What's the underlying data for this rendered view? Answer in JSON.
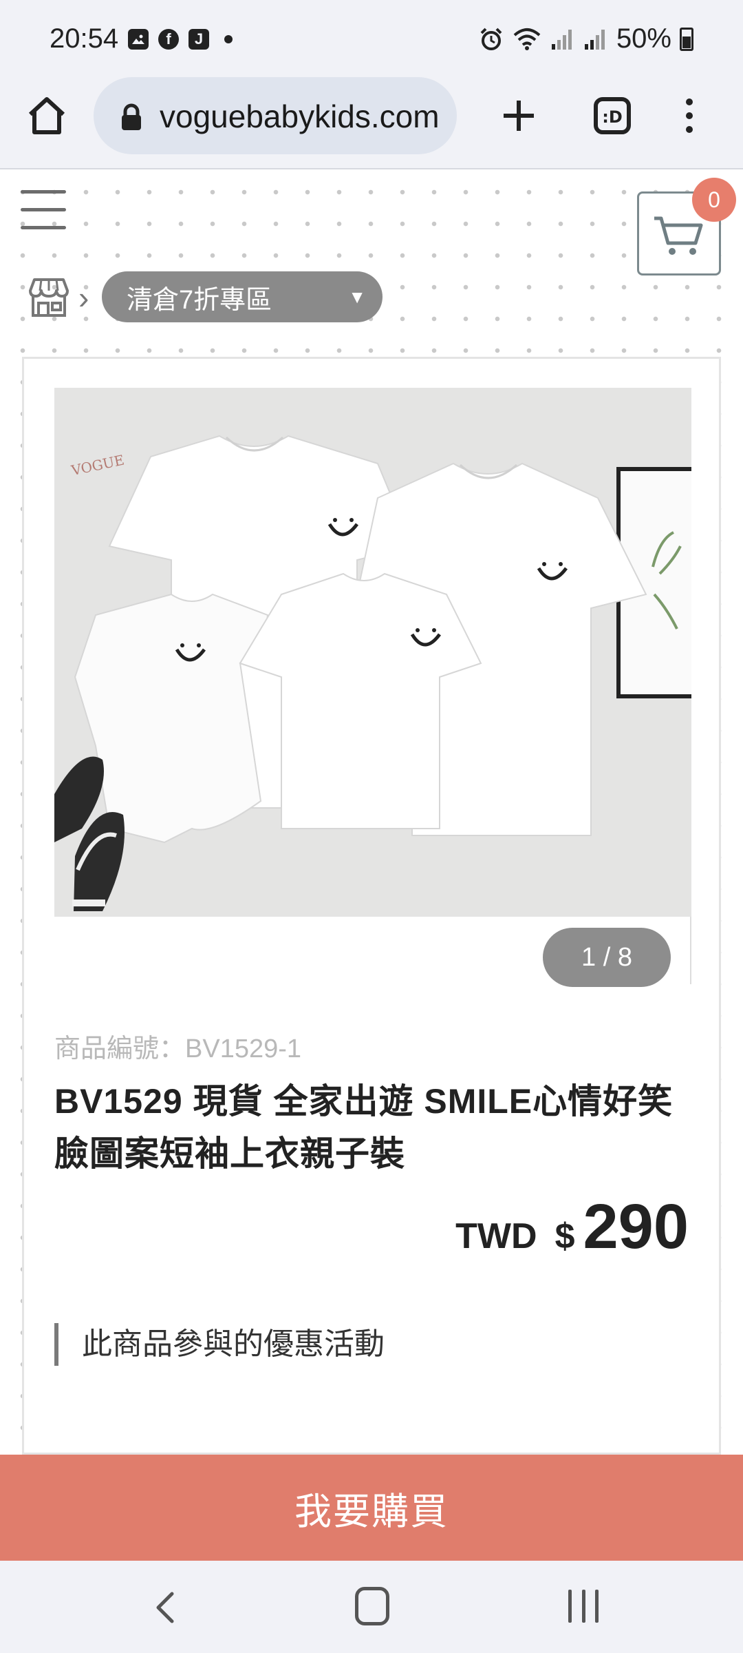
{
  "status_bar": {
    "time": "20:54",
    "left_icons": [
      "gallery-icon",
      "facebook-icon",
      "j-app-icon",
      "dot-icon"
    ],
    "right_icons": [
      "alarm-icon",
      "wifi-icon",
      "signal-icon",
      "signal-icon",
      "battery-icon"
    ],
    "battery": "50%"
  },
  "browser": {
    "url": "voguebabykids.com",
    "icons": [
      "home-icon",
      "lock-icon",
      "new-tab-icon",
      "tab-switcher-icon",
      "more-menu-icon"
    ]
  },
  "header": {
    "cart_count": "0",
    "icons": [
      "hamburger-menu-icon",
      "cart-icon"
    ]
  },
  "breadcrumb": {
    "icons": [
      "store-icon",
      "chevron-right-icon"
    ],
    "category": "清倉7折專區"
  },
  "product": {
    "image_counter": "1 / 8",
    "sku": "商品編號：BV1529-1",
    "title": "BV1529 現貨 全家出遊 SMILE心情好笑臉圖案短袖上衣親子裝",
    "price_currency": "TWD",
    "price_symbol": "$",
    "price_value": "290",
    "promo_heading": "此商品參與的優惠活動"
  },
  "actions": {
    "buy_label": "我要購買"
  },
  "system_nav": {
    "icons": [
      "back-icon",
      "home-icon",
      "recent-apps-icon"
    ]
  },
  "colors": {
    "accent": "#e07d6c",
    "badge": "#e77e6c",
    "chrome_bg": "#f1f2f7",
    "pill": "#8a8a8a"
  }
}
